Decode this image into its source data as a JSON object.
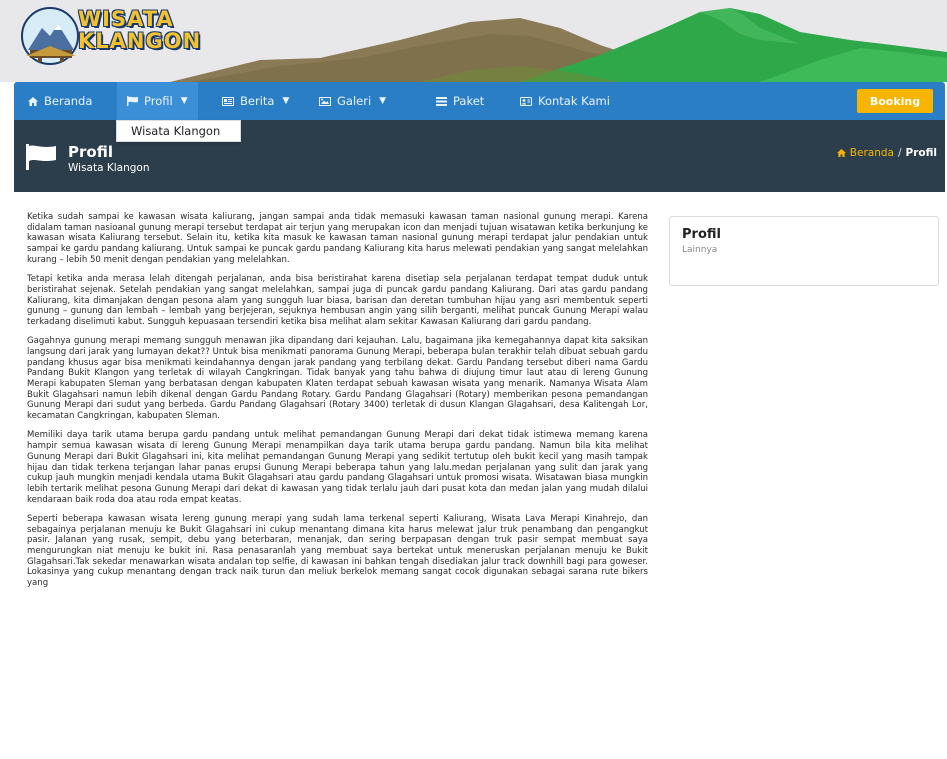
{
  "logo": {
    "line1": "WISATA",
    "line2": "KLANGON"
  },
  "nav": {
    "items": [
      {
        "label": "Beranda",
        "icon": "home-icon"
      },
      {
        "label": "Profil",
        "icon": "flag-icon"
      },
      {
        "label": "Berita",
        "icon": "newspaper-icon"
      },
      {
        "label": "Galeri",
        "icon": "image-icon"
      },
      {
        "label": "Paket",
        "icon": "list-icon"
      },
      {
        "label": "Kontak Kami",
        "icon": "contact-icon"
      }
    ],
    "booking_label": "Booking",
    "dropdown_item": "Wisata Klangon"
  },
  "page_header": {
    "title": "Profil",
    "subtitle": "Wisata Klangon",
    "breadcrumb_home": "Beranda",
    "breadcrumb_sep": "/",
    "breadcrumb_current": "Profil"
  },
  "article": {
    "paragraphs": [
      "Ketika sudah sampai ke kawasan wisata kaliurang, jangan sampai anda tidak memasuki kawasan taman nasional gunung merapi. Karena didalam taman nasioanal gunung merapi tersebut terdapat air terjun yang merupakan icon dan menjadi tujuan wisatawan ketika berkunjung ke kawasan wisata Kaliurang tersebut. Selain itu, ketika kita masuk ke kawasan taman nasional gunung merapi terdapat jalur pendakian untuk sampai ke gardu pandang kaliurang. Untuk sampai ke puncak gardu pandang Kaliurang kita harus melewati pendakian yang sangat melelahkan kurang – lebih 50 menit dengan pendakian yang melelahkan.",
      "Tetapi ketika anda merasa lelah ditengah perjalanan, anda bisa beristirahat karena disetiap sela perjalanan terdapat tempat duduk untuk beristirahat sejenak. Setelah pendakian yang sangat melelahkan, sampai juga di puncak gardu pandang Kaliurang. Dari atas gardu pandang Kaliurang, kita dimanjakan dengan pesona alam yang sungguh luar biasa, barisan dan deretan tumbuhan hijau yang asri membentuk seperti gunung – gunung dan lembah – lembah yang berjejeran, sejuknya hembusan angin yang silih berganti, melihat puncak Gunung Merapi walau terkadang diselimuti kabut. Sungguh kepuasaan tersendiri ketika bisa melihat alam sekitar Kawasan Kaliurang dari gardu pandang.",
      "Gagahnya gunung merapi memang sungguh menawan jika dipandang dari kejauhan. Lalu, bagaimana jika kemegahannya dapat kita saksikan langsung dari jarak yang lumayan dekat?? Untuk bisa menikmati panorama Gunung Merapi, beberapa bulan terakhir telah dibuat sebuah gardu pandang khusus agar bisa menikmati keindahannya dengan jarak pandang yang terbilang dekat. Gardu Pandang tersebut diberi nama Gardu Pandang Bukit Klangon yang terletak di wilayah Cangkringan. Tidak banyak yang tahu bahwa di diujung timur laut atau di lereng Gunung Merapi kabupaten Sleman yang berbatasan dengan kabupaten Klaten terdapat sebuah kawasan wisata yang menarik. Namanya Wisata Alam Bukit Glagahsari namun lebih dikenal dengan Gardu Pandang Rotary. Gardu Pandang Glagahsari (Rotary) memberikan pesona pemandangan Gunung Merapi dari sudut yang berbeda. Gardu Pandang Glagahsari (Rotary 3400) terletak di dusun Klangan Glagahsari, desa Kalitengah Lor, kecamatan Cangkringan, kabupaten Sleman.",
      "Memiliki daya tarik utama berupa gardu pandang untuk melihat pemandangan Gunung Merapi dari dekat tidak istimewa memang karena hampir semua kawasan wisata di lereng Gunung Merapi menampilkan daya tarik utama berupa gardu pandang. Namun bila kita melihat Gunung Merapi dari Bukit Glagahsari ini, kita melihat pemandangan Gunung Merapi yang sedikit tertutup oleh bukit kecil yang masih tampak hijau dan tidak terkena terjangan lahar panas erupsi Gunung Merapi beberapa tahun yang lalu.medan perjalanan yang sulit dan jarak yang cukup jauh mungkin menjadi kendala utama Bukit Glagahsari atau gardu pandang Glagahsari untuk promosi wisata. Wisatawan biasa mungkin lebih tertarik melihat pesona Gunung Merapi dari dekat di kawasan yang tidak terlalu jauh dari pusat kota dan medan jalan yang mudah dilalui kendaraan baik roda doa atau roda empat keatas.",
      "Seperti beberapa kawasan wisata lereng gunung merapi yang sudah lama terkenal seperti Kaliurang, Wisata Lava Merapi Kinahrejo, dan sebagainya perjalanan menuju ke Bukit Glagahsari ini cukup menantang dimana kita harus melewat jalur truk penambang dan pengangkut pasir. Jalanan yang rusak, sempit, debu yang beterbaran, menanjak, dan sering berpapasan dengan truk pasir sempat membuat saya mengurungkan niat menuju ke bukit ini. Rasa penasaranlah yang membuat saya bertekat untuk meneruskan perjalanan menuju ke Bukit Glagahsari.Tak sekedar menawarkan wisata andalan top selfie, di kawasan ini bahkan tengah disediakan jalur track downhill bagi para goweser. Lokasinya yang cukup menantang dengan track naik turun dan meliuk berkelok memang sangat cocok digunakan sebagai sarana rute bikers yang"
    ]
  },
  "sidebar": {
    "title": "Profil",
    "subtitle": "Lainnya"
  },
  "colors": {
    "nav_blue": "#2a7ec6",
    "header_dark": "#2c3e4c",
    "booking_yellow": "#f7b500",
    "mountain_brown": "#8a7a55",
    "mountain_green": "#2fa84a"
  }
}
